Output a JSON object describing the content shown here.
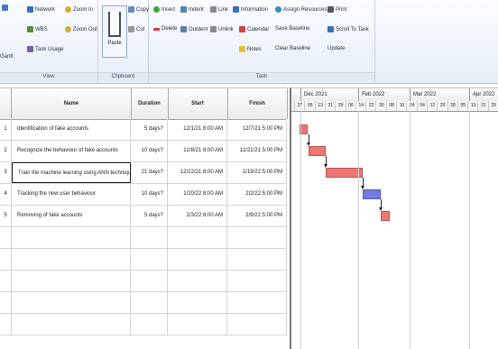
{
  "ribbon": {
    "task_group": {
      "label": "View",
      "items": [
        "Network",
        "WBS",
        "Task Usage",
        "Zoom In",
        "Zoom Out"
      ],
      "left_partial": [
        "Gantt"
      ]
    },
    "clipboard_group": {
      "label": "Clipboard",
      "paste": "Paste",
      "copy": "Copy",
      "cut": "Cut"
    },
    "tasks_group": {
      "label": "Task",
      "items": [
        "Insert",
        "Delete",
        "Indent",
        "Outdent",
        "Link",
        "Unlink",
        "Information",
        "Calendar",
        "Notes",
        "Assign Resources",
        "Save Baseline",
        "Clear Baseline",
        "Print",
        "Scroll To Task",
        "Update"
      ]
    }
  },
  "table": {
    "columns": [
      "",
      "Name",
      "Duration",
      "Start",
      "Finish"
    ],
    "rows": [
      {
        "id": "1",
        "name": "Identification of fake accounts",
        "duration": "5 days?",
        "start": "12/1/21 8:00 AM",
        "finish": "12/7/21 5:00 PM"
      },
      {
        "id": "2",
        "name": "Recognize the behaviour of fake accounts",
        "duration": "10 days?",
        "start": "12/8/21 8:00 AM",
        "finish": "12/21/21 5:00 PM"
      },
      {
        "id": "3",
        "name": "Train the machine learning using ANN technique",
        "duration": "21 days?",
        "start": "12/22/21 8:00 AM",
        "finish": "1/19/22 5:00 PM"
      },
      {
        "id": "4",
        "name": "Tracking the new user behaviour",
        "duration": "10 days?",
        "start": "1/20/22 8:00 AM",
        "finish": "2/2/22 5:00 PM"
      },
      {
        "id": "5",
        "name": "Removing of fake accounts",
        "duration": "5 days?",
        "start": "2/3/22 8:00 AM",
        "finish": "2/9/22 5:00 PM"
      }
    ]
  },
  "gantt": {
    "months": [
      "Dec 2021",
      "Feb 2022",
      "Mar 2022",
      "Apr 2022"
    ],
    "days": [
      "27",
      "05",
      "13",
      "21",
      "29",
      "06",
      "14",
      "22",
      "30",
      "08",
      "16",
      "24",
      "04",
      "12",
      "20",
      "28",
      "05",
      "13",
      "21",
      "29"
    ],
    "colors": {
      "task_bar": "#f07575",
      "critical_bar": "#7379e6",
      "link": "#222222"
    },
    "bars": [
      {
        "start": "12/1/21",
        "finish": "12/7/21",
        "color": "task_bar"
      },
      {
        "start": "12/8/21",
        "finish": "12/21/21",
        "color": "task_bar"
      },
      {
        "start": "12/22/21",
        "finish": "1/19/22",
        "color": "task_bar"
      },
      {
        "start": "1/20/22",
        "finish": "2/2/22",
        "color": "critical_bar"
      },
      {
        "start": "2/3/22",
        "finish": "2/9/22",
        "color": "task_bar"
      }
    ]
  }
}
